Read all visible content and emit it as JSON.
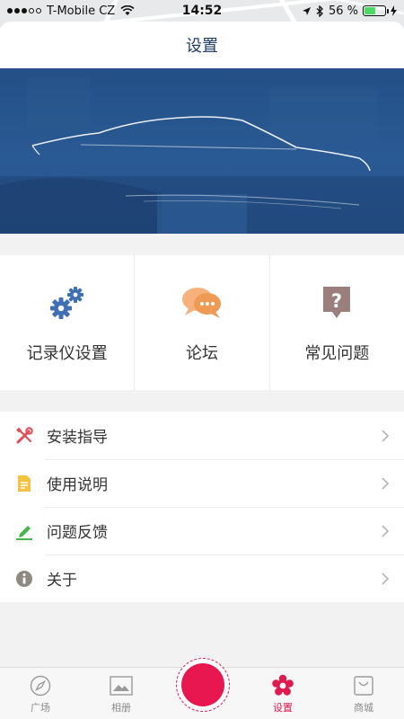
{
  "status_bar": {
    "carrier": "T-Mobile CZ",
    "time": "14:52",
    "battery": "56 %",
    "battery_level": 0.56
  },
  "header": {
    "title": "设置"
  },
  "grid": [
    {
      "label": "记录仪设置",
      "icon": "gears-icon",
      "color": "#3f6fb5"
    },
    {
      "label": "论坛",
      "icon": "chat-bubbles-icon",
      "color": "#f1a15d"
    },
    {
      "label": "常见问题",
      "icon": "question-tag-icon",
      "color": "#9a7f7d"
    }
  ],
  "list": [
    {
      "label": "安装指导",
      "icon": "tools-icon",
      "color": "#e34c55"
    },
    {
      "label": "使用说明",
      "icon": "document-icon",
      "color": "#f6c244"
    },
    {
      "label": "问题反馈",
      "icon": "edit-pencil-icon",
      "color": "#47b64a"
    },
    {
      "label": "关于",
      "icon": "info-icon",
      "color": "#8f8981"
    }
  ],
  "tabs": [
    {
      "label": "广场",
      "icon": "compass-icon"
    },
    {
      "label": "相册",
      "icon": "photo-album-icon"
    },
    {
      "label": "",
      "icon": "record-button"
    },
    {
      "label": "设置",
      "icon": "flower-gear-icon",
      "active": true
    },
    {
      "label": "商城",
      "icon": "shopping-bag-icon"
    }
  ],
  "colors": {
    "accent": "#e0194f",
    "title": "#1e3c6e",
    "banner": "#2a5a94"
  }
}
